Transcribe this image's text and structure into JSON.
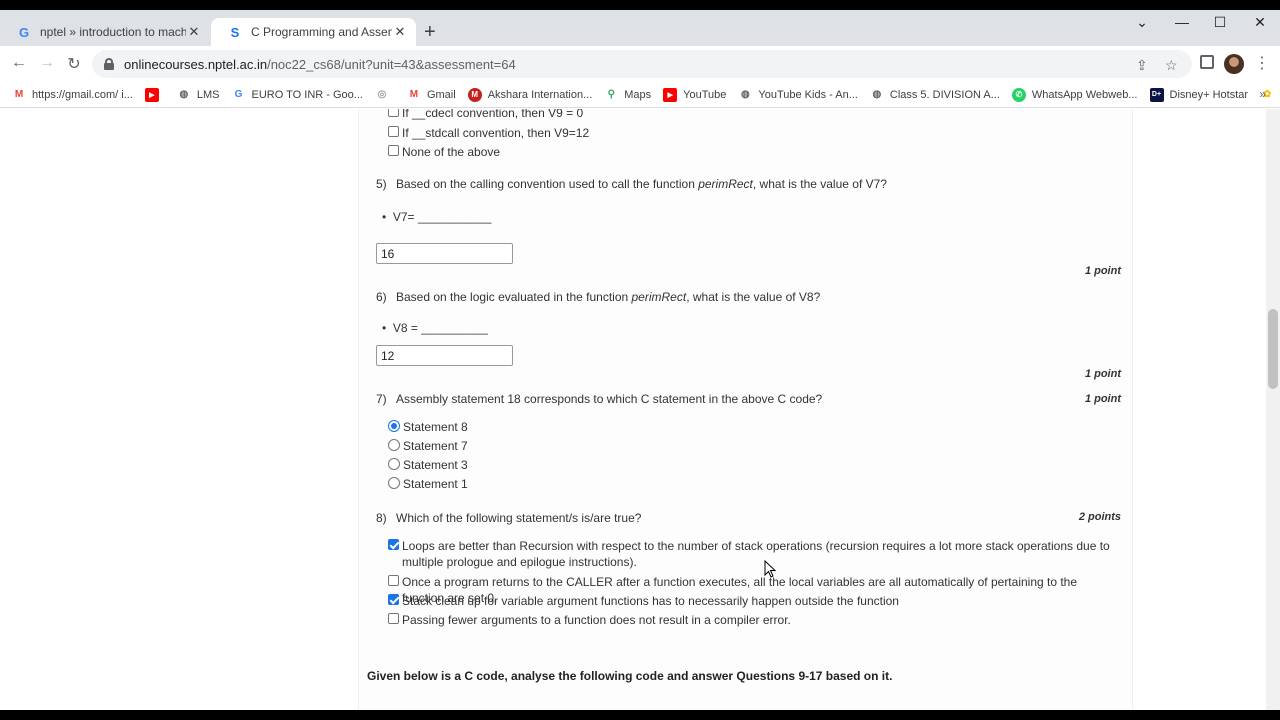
{
  "browser": {
    "tabs": [
      {
        "title": "nptel » introduction to machine",
        "favicon": "google-g"
      },
      {
        "title": "C Programming and Assembly La",
        "favicon": "swayam-s"
      }
    ],
    "url_host": "onlinecourses.nptel.ac.in",
    "url_path": "/noc22_cs68/unit?unit=43&assessment=64",
    "bookmarks": [
      {
        "label": "https://gmail.com/ i...",
        "icon": "gmail-icon"
      },
      {
        "label": "",
        "icon": "youtube-icon"
      },
      {
        "label": "LMS",
        "icon": "globe-icon"
      },
      {
        "label": "EURO TO INR - Goo...",
        "icon": "google-icon"
      },
      {
        "label": "",
        "icon": "extension-icon"
      },
      {
        "label": "Gmail",
        "icon": "gmail-icon"
      },
      {
        "label": "Akshara Internation...",
        "icon": "akshara-icon"
      },
      {
        "label": "Maps",
        "icon": "maps-icon"
      },
      {
        "label": "YouTube",
        "icon": "youtube-icon"
      },
      {
        "label": "YouTube Kids - An...",
        "icon": "globe-icon"
      },
      {
        "label": "Class 5. DIVISION A...",
        "icon": "globe-icon"
      },
      {
        "label": "WhatsApp Webweb...",
        "icon": "whatsapp-icon"
      },
      {
        "label": "Disney+ Hotstar",
        "icon": "hotstar-icon"
      },
      {
        "label": "",
        "icon": "photos-icon"
      }
    ]
  },
  "quiz": {
    "prev_options": [
      {
        "text": "If __cdecl convention, then V9 = 0",
        "checked": false
      },
      {
        "text": "If __stdcall convention, then V9=12",
        "checked": false
      },
      {
        "text": "None of the above",
        "checked": false
      }
    ],
    "q5": {
      "num": "5)",
      "text_before": "Based on the calling convention used to call the function ",
      "func": "perimRect",
      "text_after": ", what is the value of V7?",
      "bullet": "V7= ___________",
      "answer": "16",
      "points": "1 point"
    },
    "q6": {
      "num": "6)",
      "text_before": "Based on the logic evaluated in the function ",
      "func": "perimRect",
      "text_after": ", what is the value of V8?",
      "bullet": "V8 = __________",
      "answer": "12",
      "points": "1 point"
    },
    "q7": {
      "num": "7)",
      "text": "Assembly statement 18 corresponds to which C statement in the above C code?",
      "points": "1 point",
      "options": [
        {
          "text": "Statement 8",
          "checked": true
        },
        {
          "text": "Statement 7",
          "checked": false
        },
        {
          "text": "Statement 3",
          "checked": false
        },
        {
          "text": "Statement 1",
          "checked": false
        }
      ]
    },
    "q8": {
      "num": "8)",
      "text": "Which of the following statement/s is/are true?",
      "points": "2 points",
      "options": [
        {
          "text": "Loops are better than Recursion with respect to the number of stack operations (recursion requires a lot more stack operations due to multiple prologue and epilogue instructions).",
          "checked": true
        },
        {
          "text": "Once a program returns to the CALLER after a function executes, all the local variables are all automatically of pertaining to the function are set 0.",
          "checked": false
        },
        {
          "text": "Stack clean up for variable argument functions has to necessarily happen outside the function",
          "checked": true
        },
        {
          "text": "Passing fewer arguments to a function does not result in a compiler error.",
          "checked": false
        }
      ]
    },
    "note": "Given below is a C code, analyse the following code and answer Questions 9-17 based on it."
  }
}
